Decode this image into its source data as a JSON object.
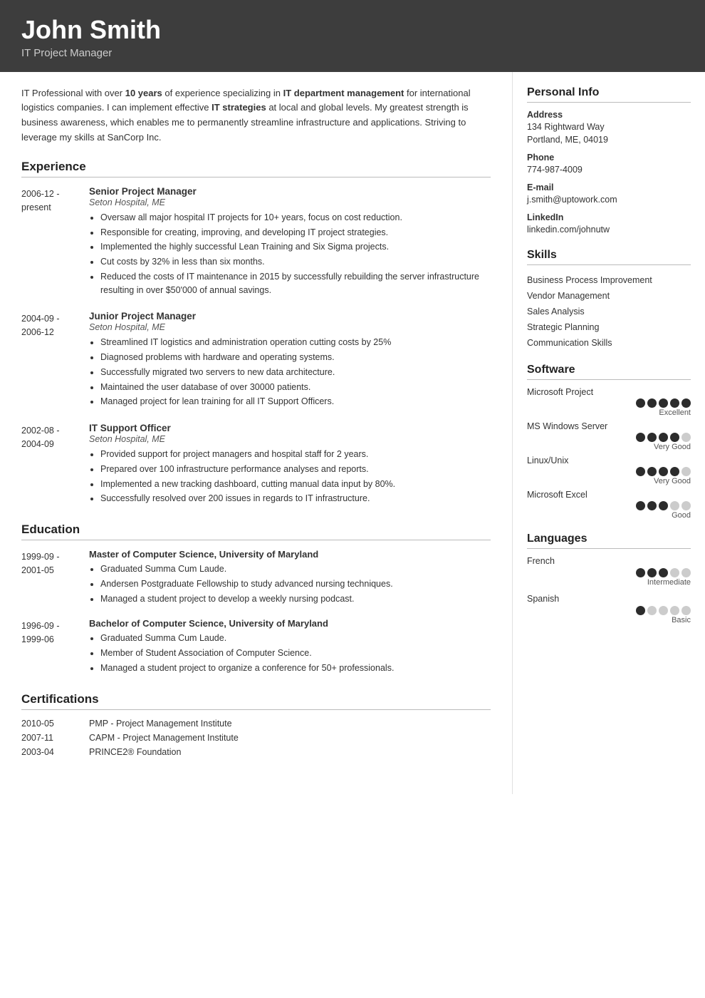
{
  "header": {
    "name": "John Smith",
    "title": "IT Project Manager"
  },
  "summary": {
    "text_parts": [
      "IT Professional with over ",
      "10 years",
      " of experience specializing in ",
      "IT department management",
      " for international logistics companies. I can implement effective ",
      "IT strategies",
      " at local and global levels. My greatest strength is business awareness, which enables me to permanently streamline infrastructure and applications. Striving to leverage my skills at SanCorp Inc."
    ]
  },
  "experience": {
    "section_title": "Experience",
    "entries": [
      {
        "date_from": "2006-12 -",
        "date_to": "present",
        "role": "Senior Project Manager",
        "company": "Seton Hospital, ME",
        "bullets": [
          "Oversaw all major hospital IT projects for 10+ years, focus on cost reduction.",
          "Responsible for creating, improving, and developing IT project strategies.",
          "Implemented the highly successful Lean Training and Six Sigma projects.",
          "Cut costs by 32% in less than six months.",
          "Reduced the costs of IT maintenance in 2015 by successfully rebuilding the server infrastructure resulting in over $50'000 of annual savings."
        ]
      },
      {
        "date_from": "2004-09 -",
        "date_to": "2006-12",
        "role": "Junior Project Manager",
        "company": "Seton Hospital, ME",
        "bullets": [
          "Streamlined IT logistics and administration operation cutting costs by 25%",
          "Diagnosed problems with hardware and operating systems.",
          "Successfully migrated two servers to new data architecture.",
          "Maintained the user database of over 30000 patients.",
          "Managed project for lean training for all IT Support Officers."
        ]
      },
      {
        "date_from": "2002-08 -",
        "date_to": "2004-09",
        "role": "IT Support Officer",
        "company": "Seton Hospital, ME",
        "bullets": [
          "Provided support for project managers and hospital staff for 2 years.",
          "Prepared over 100 infrastructure performance analyses and reports.",
          "Implemented a new tracking dashboard, cutting manual data input by 80%.",
          "Successfully resolved over 200 issues in regards to IT infrastructure."
        ]
      }
    ]
  },
  "education": {
    "section_title": "Education",
    "entries": [
      {
        "date_from": "1999-09 -",
        "date_to": "2001-05",
        "degree": "Master of Computer Science, University of Maryland",
        "bullets": [
          "Graduated Summa Cum Laude.",
          "Andersen Postgraduate Fellowship to study advanced nursing techniques.",
          "Managed a student project to develop a weekly nursing podcast."
        ]
      },
      {
        "date_from": "1996-09 -",
        "date_to": "1999-06",
        "degree": "Bachelor of Computer Science, University of Maryland",
        "bullets": [
          "Graduated Summa Cum Laude.",
          "Member of Student Association of Computer Science.",
          "Managed a student project to organize a conference for 50+ professionals."
        ]
      }
    ]
  },
  "certifications": {
    "section_title": "Certifications",
    "entries": [
      {
        "date": "2010-05",
        "name": "PMP - Project Management Institute"
      },
      {
        "date": "2007-11",
        "name": "CAPM - Project Management Institute"
      },
      {
        "date": "2003-04",
        "name": "PRINCE2® Foundation"
      }
    ]
  },
  "personal_info": {
    "section_title": "Personal Info",
    "fields": [
      {
        "label": "Address",
        "value": "134 Rightward Way\nPortland, ME, 04019"
      },
      {
        "label": "Phone",
        "value": "774-987-4009"
      },
      {
        "label": "E-mail",
        "value": "j.smith@uptowork.com"
      },
      {
        "label": "LinkedIn",
        "value": "linkedin.com/johnutw"
      }
    ]
  },
  "skills": {
    "section_title": "Skills",
    "items": [
      "Business Process Improvement",
      "Vendor Management",
      "Sales Analysis",
      "Strategic Planning",
      "Communication Skills"
    ]
  },
  "software": {
    "section_title": "Software",
    "items": [
      {
        "name": "Microsoft Project",
        "filled": 5,
        "total": 5,
        "label": "Excellent"
      },
      {
        "name": "MS Windows Server",
        "filled": 4,
        "total": 5,
        "label": "Very Good"
      },
      {
        "name": "Linux/Unix",
        "filled": 4,
        "total": 5,
        "label": "Very Good"
      },
      {
        "name": "Microsoft Excel",
        "filled": 3,
        "total": 5,
        "label": "Good"
      }
    ]
  },
  "languages": {
    "section_title": "Languages",
    "items": [
      {
        "name": "French",
        "filled": 3,
        "total": 5,
        "label": "Intermediate"
      },
      {
        "name": "Spanish",
        "filled": 1,
        "total": 5,
        "label": "Basic"
      }
    ]
  }
}
